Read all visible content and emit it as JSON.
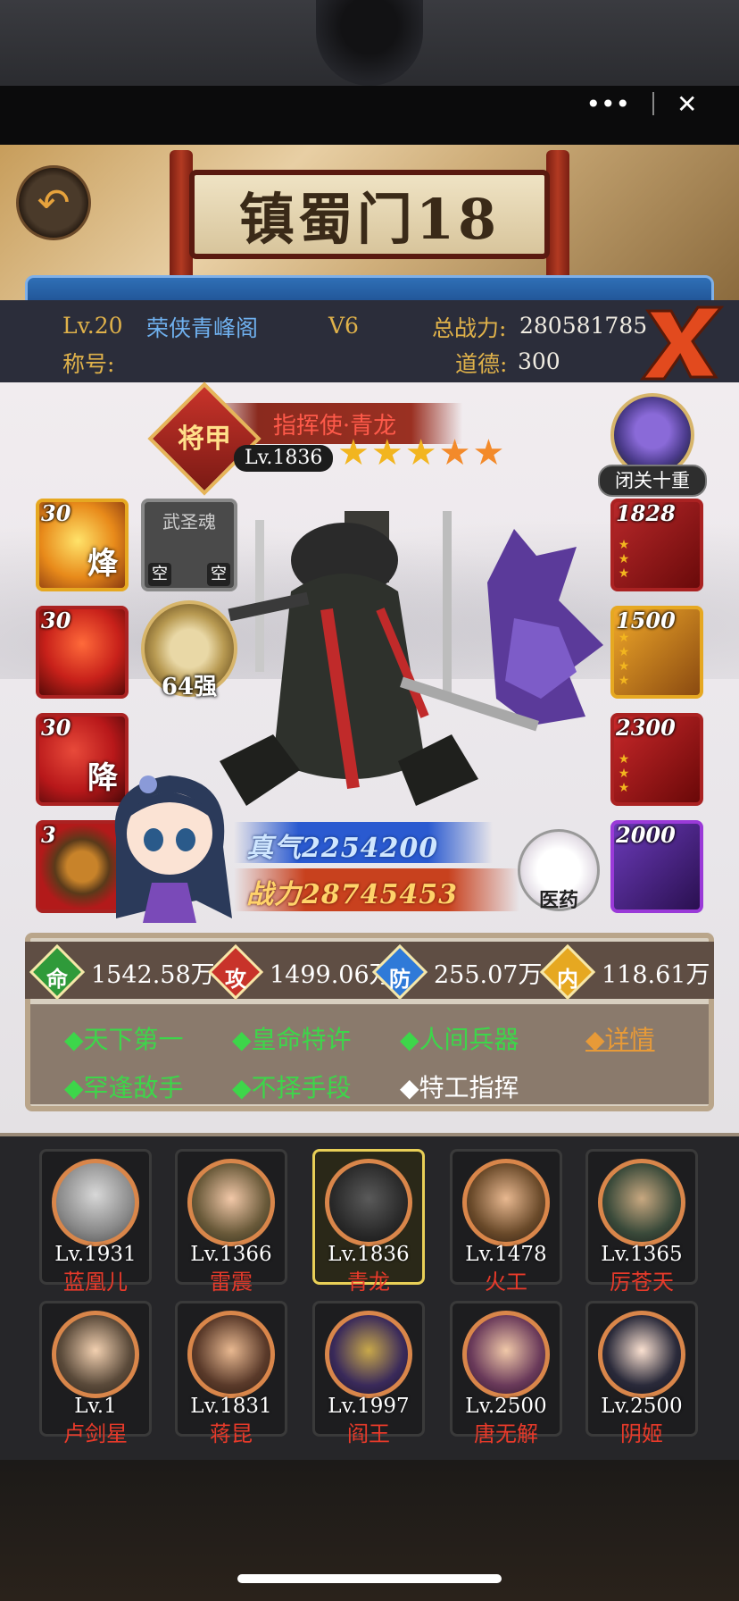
{
  "scene": {
    "sign_text": "镇蜀门18"
  },
  "mini_program": {
    "more_label": "•••",
    "close_label": "✕"
  },
  "header": {
    "level": "Lv.20",
    "guild": "荣侠青峰阁",
    "vip": "V6",
    "total_power_label": "总战力:",
    "total_power": "280581785",
    "title_label": "称号:",
    "morality_label": "道德:",
    "morality": "300"
  },
  "hero": {
    "class_badge": "将甲",
    "name": "指挥使·青龙",
    "level": "Lv.1836",
    "stars": 5,
    "meditation_label": "闭关十重",
    "qi": "真气2254200",
    "power": "战力28745453",
    "strength": "64强",
    "medicine_label": "医药",
    "empty_slot_title": "武圣魂",
    "empty_slot_tag": "空"
  },
  "skills": [
    {
      "num": "30",
      "glyph": "烽"
    },
    {
      "num": "30",
      "glyph": ""
    },
    {
      "num": "30",
      "glyph": "降"
    },
    {
      "num": "3",
      "glyph": ""
    }
  ],
  "equipment": [
    {
      "num": "1828"
    },
    {
      "num": "1500"
    },
    {
      "num": "2300"
    },
    {
      "num": "2000"
    }
  ],
  "stats": [
    {
      "icon": "命",
      "value": "1542.58万",
      "color": "#2f9a3a"
    },
    {
      "icon": "攻",
      "value": "1499.06万",
      "color": "#c8332a"
    },
    {
      "icon": "防",
      "value": "255.07万",
      "color": "#2f7ad8"
    },
    {
      "icon": "内",
      "value": "118.61万",
      "color": "#e6a821"
    }
  ],
  "traits": {
    "row1": [
      "◆天下第一",
      "◆皇命特许",
      "◆人间兵器"
    ],
    "details": "◆详情",
    "row2": [
      "◆罕逢敌手",
      "◆不择手段"
    ],
    "row2_white": "◆特工指挥"
  },
  "roster": [
    {
      "level": "Lv.1931",
      "name": "蓝凰儿",
      "selected": false
    },
    {
      "level": "Lv.1366",
      "name": "雷震",
      "selected": false
    },
    {
      "level": "Lv.1836",
      "name": "青龙",
      "selected": true
    },
    {
      "level": "Lv.1478",
      "name": "火工",
      "selected": false
    },
    {
      "level": "Lv.1365",
      "name": "厉苍天",
      "selected": false
    },
    {
      "level": "Lv.1",
      "name": "卢剑星",
      "selected": false
    },
    {
      "level": "Lv.1831",
      "name": "蒋昆",
      "selected": false
    },
    {
      "level": "Lv.1997",
      "name": "阎王",
      "selected": false
    },
    {
      "level": "Lv.2500",
      "name": "唐无解",
      "selected": false
    },
    {
      "level": "Lv.2500",
      "name": "阴姬",
      "selected": false
    }
  ]
}
